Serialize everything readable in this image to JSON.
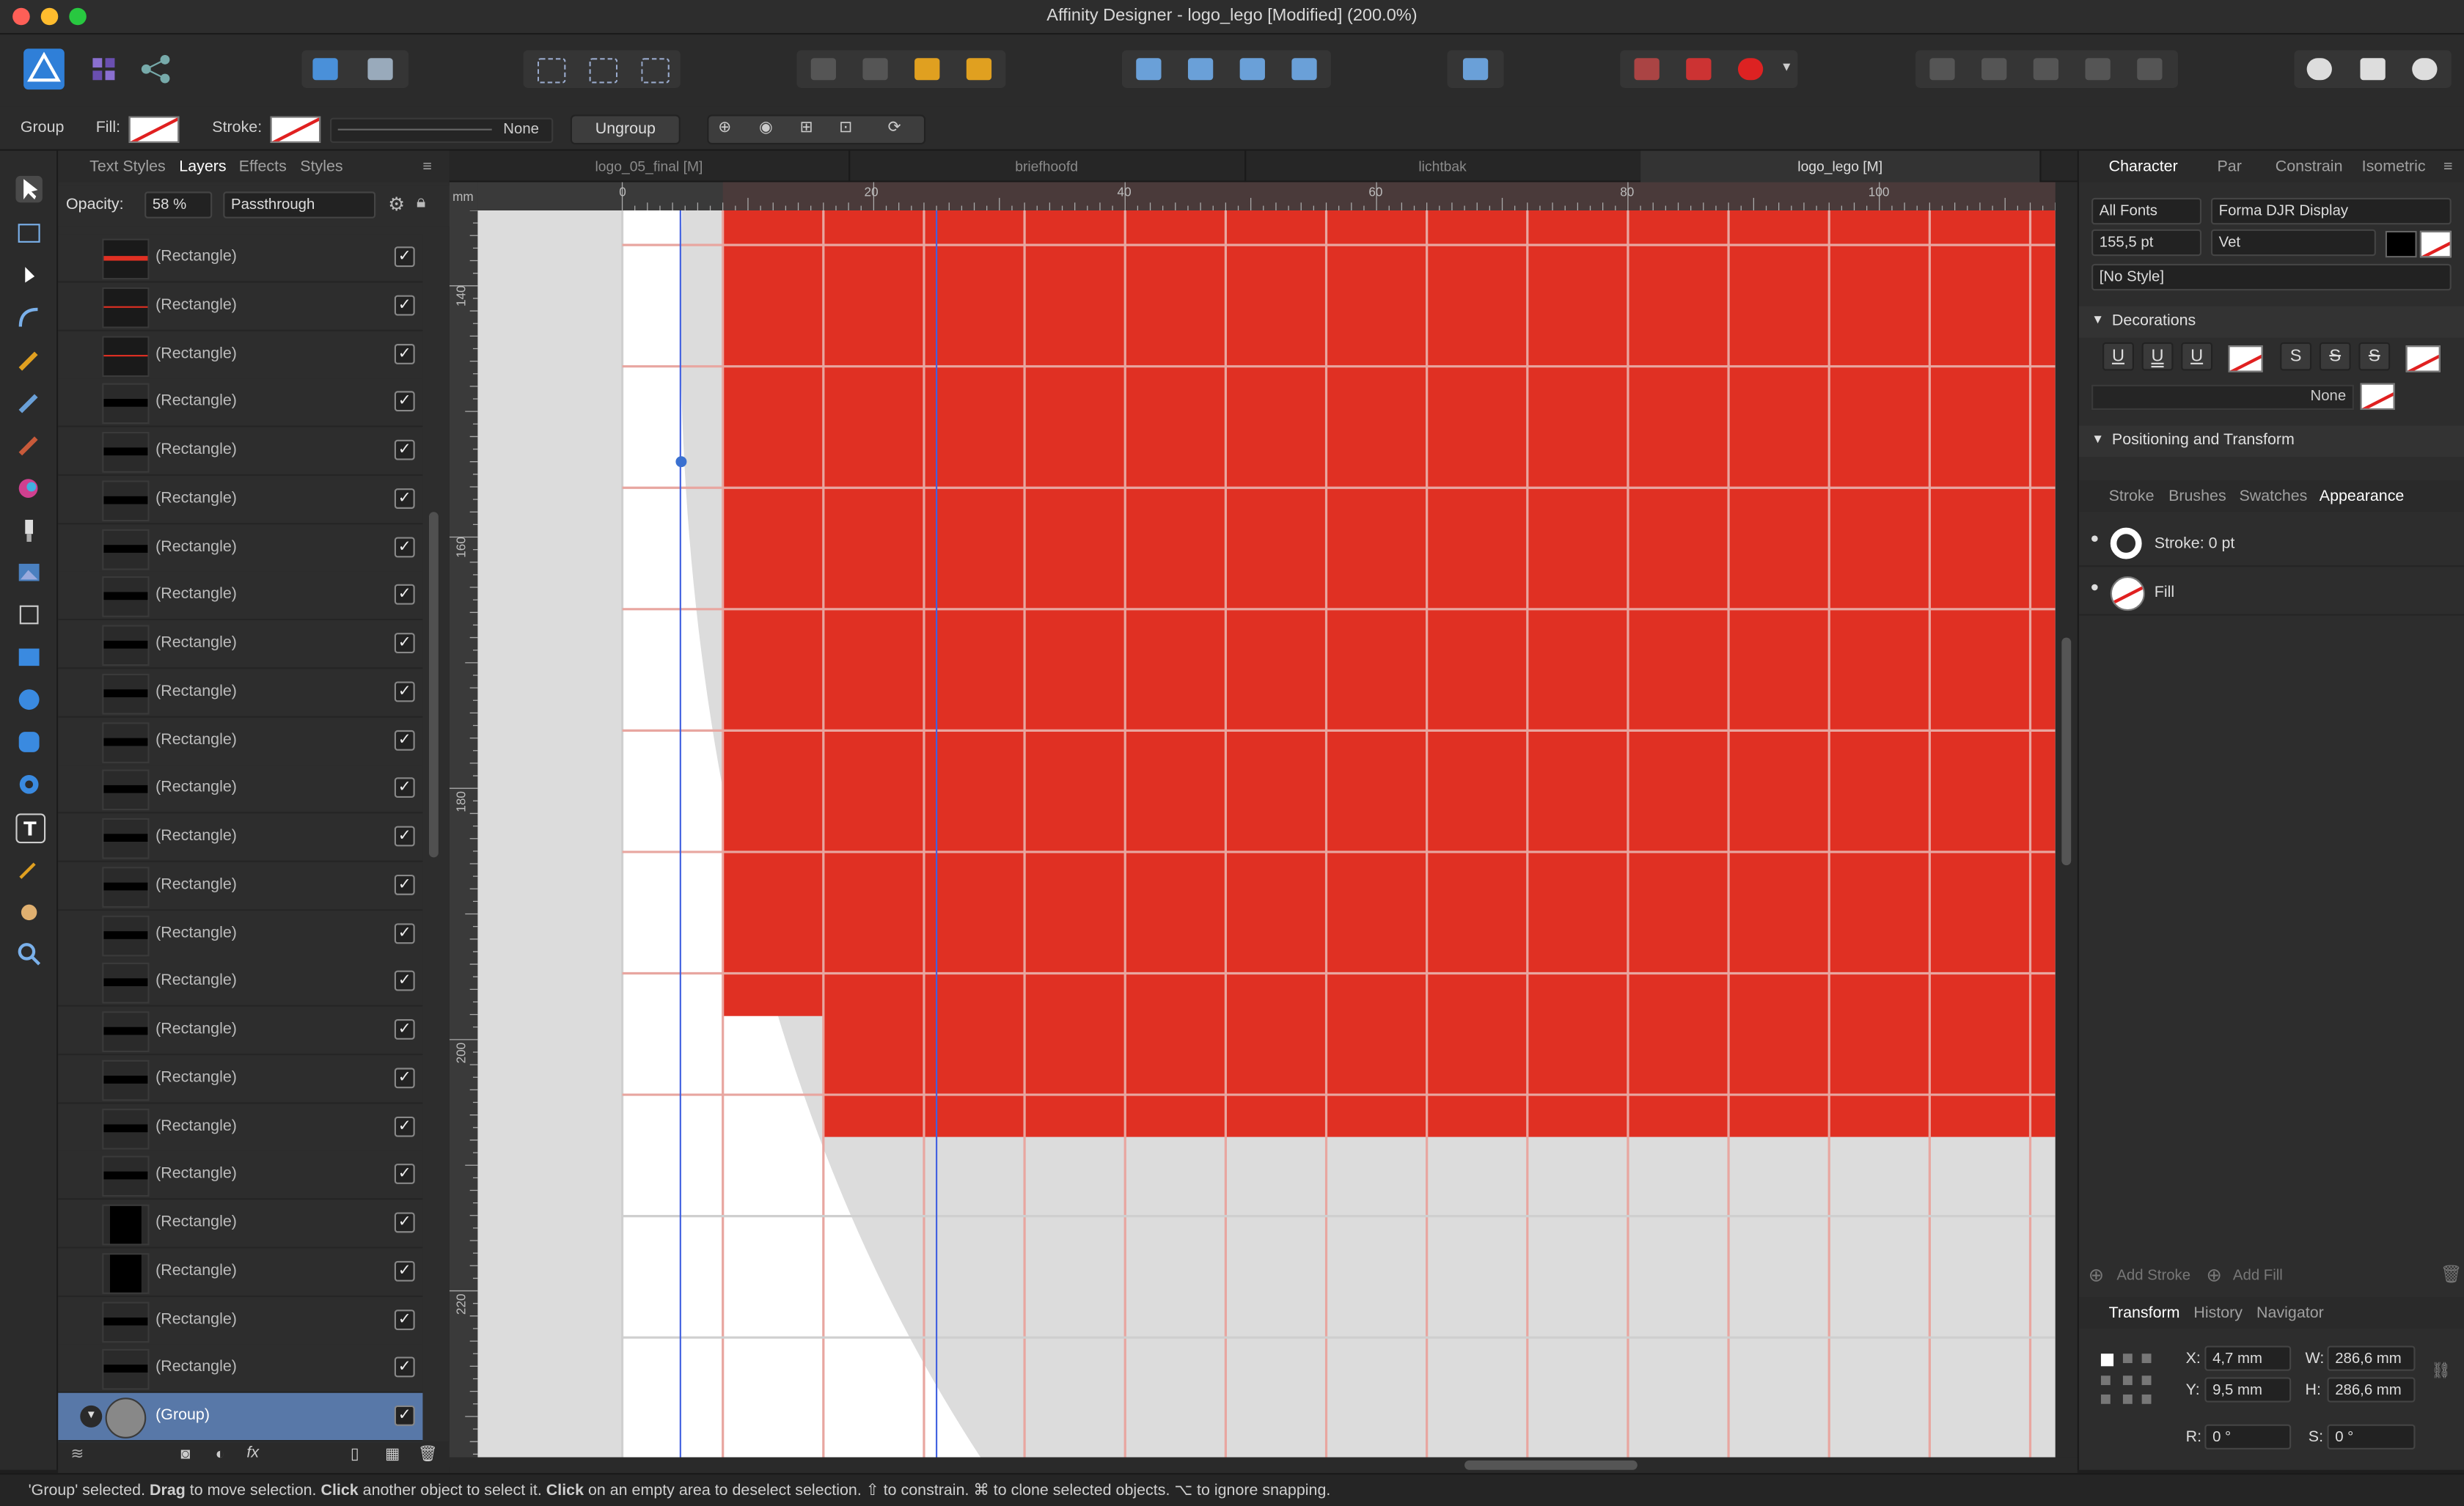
{
  "window": {
    "title": "Affinity Designer - logo_lego [Modified] (200.0%)"
  },
  "context_bar": {
    "selection_type": "Group",
    "fill_label": "Fill:",
    "stroke_label": "Stroke:",
    "stroke_style": "None",
    "ungroup_label": "Ungroup"
  },
  "layers_panel": {
    "tabs": [
      "Text Styles",
      "Layers",
      "Effects",
      "Styles"
    ],
    "active_tab": "Layers",
    "opacity_label": "Opacity:",
    "opacity_value": "58 %",
    "blend_mode": "Passthrough",
    "items": [
      {
        "name": "(Rectangle)",
        "thumb": "red-thick",
        "checked": "✓"
      },
      {
        "name": "(Rectangle)",
        "thumb": "red-line",
        "checked": "✓"
      },
      {
        "name": "(Rectangle)",
        "thumb": "red-line",
        "checked": "✓"
      },
      {
        "name": "(Rectangle)",
        "thumb": "black-line",
        "checked": "✓"
      },
      {
        "name": "(Rectangle)",
        "thumb": "black-line",
        "checked": "✓"
      },
      {
        "name": "(Rectangle)",
        "thumb": "black-line",
        "checked": "✓"
      },
      {
        "name": "(Rectangle)",
        "thumb": "black-line",
        "checked": "✓"
      },
      {
        "name": "(Rectangle)",
        "thumb": "black-line",
        "checked": "✓"
      },
      {
        "name": "(Rectangle)",
        "thumb": "black-line",
        "checked": "✓"
      },
      {
        "name": "(Rectangle)",
        "thumb": "black-line",
        "checked": "✓"
      },
      {
        "name": "(Rectangle)",
        "thumb": "black-line",
        "checked": "✓"
      },
      {
        "name": "(Rectangle)",
        "thumb": "black-line",
        "checked": "✓"
      },
      {
        "name": "(Rectangle)",
        "thumb": "black-line",
        "checked": "✓"
      },
      {
        "name": "(Rectangle)",
        "thumb": "black-line",
        "checked": "✓"
      },
      {
        "name": "(Rectangle)",
        "thumb": "black-line",
        "checked": "✓"
      },
      {
        "name": "(Rectangle)",
        "thumb": "black-line",
        "checked": "✓"
      },
      {
        "name": "(Rectangle)",
        "thumb": "black-line",
        "checked": "✓"
      },
      {
        "name": "(Rectangle)",
        "thumb": "black-line",
        "checked": "✓"
      },
      {
        "name": "(Rectangle)",
        "thumb": "black-line",
        "checked": "✓"
      },
      {
        "name": "(Rectangle)",
        "thumb": "black-line",
        "checked": "✓"
      },
      {
        "name": "(Rectangle)",
        "thumb": "black-block",
        "checked": "✓"
      },
      {
        "name": "(Rectangle)",
        "thumb": "black-block",
        "checked": "✓"
      },
      {
        "name": "(Rectangle)",
        "thumb": "black-line",
        "checked": "✓"
      },
      {
        "name": "(Rectangle)",
        "thumb": "black-line",
        "checked": "✓"
      },
      {
        "name": "(Group)",
        "thumb": "group",
        "checked": "✓",
        "selected": true
      }
    ]
  },
  "document_tabs": [
    "logo_05_final [M]",
    "briefhoofd",
    "lichtbak",
    "logo_lego [M]"
  ],
  "active_document": "logo_lego [M]",
  "rulers": {
    "unit": "mm",
    "horizontal": [
      "0",
      "20",
      "40",
      "60",
      "80",
      "100"
    ],
    "vertical": [
      "140",
      "160",
      "180",
      "200",
      "220"
    ]
  },
  "canvas": {
    "fill_color": "#e03023",
    "grid_color": "#e8a6a0",
    "paper_color": "#ffffff",
    "pasteboard_color": "#dcdcdc"
  },
  "character_panel": {
    "tabs": [
      "Character",
      "Par",
      "Constrain",
      "Isometric"
    ],
    "active_tab": "Character",
    "font_collection": "All Fonts",
    "font_family": "Forma DJR Display",
    "font_size": "155,5 pt",
    "font_weight": "Vet",
    "style": "[No Style]",
    "decorations_label": "Decorations",
    "decoration_buttons": [
      "U",
      "U",
      "U",
      "S",
      "S",
      "S"
    ],
    "decoration_line": "None",
    "positioning_label": "Positioning and Transform"
  },
  "appearance_panel": {
    "tabs": [
      "Stroke",
      "Brushes",
      "Swatches",
      "Appearance"
    ],
    "active_tab": "Appearance",
    "stroke_entry": "Stroke: 0 pt",
    "fill_entry": "Fill",
    "add_stroke": "Add Stroke",
    "add_fill": "Add Fill"
  },
  "transform_panel": {
    "tabs": [
      "Transform",
      "History",
      "Navigator"
    ],
    "active_tab": "Transform",
    "x_label": "X:",
    "x_value": "4,7 mm",
    "y_label": "Y:",
    "y_value": "9,5 mm",
    "w_label": "W:",
    "w_value": "286,6 mm",
    "h_label": "H:",
    "h_value": "286,6 mm",
    "r_label": "R:",
    "r_value": "0 °",
    "s_label": "S:",
    "s_value": "0 °"
  },
  "status_bar": {
    "p1": "'Group' selected. ",
    "b1": "Drag",
    "p2": " to move selection. ",
    "b2": "Click",
    "p3": " another object to select it. ",
    "b3": "Click",
    "p4": " on an empty area to deselect selection. ",
    "k1": "⇧",
    "p5": " to constrain. ",
    "k2": "⌘",
    "p6": " to clone selected objects. ",
    "k3": "⌥",
    "p7": " to ignore snapping."
  }
}
